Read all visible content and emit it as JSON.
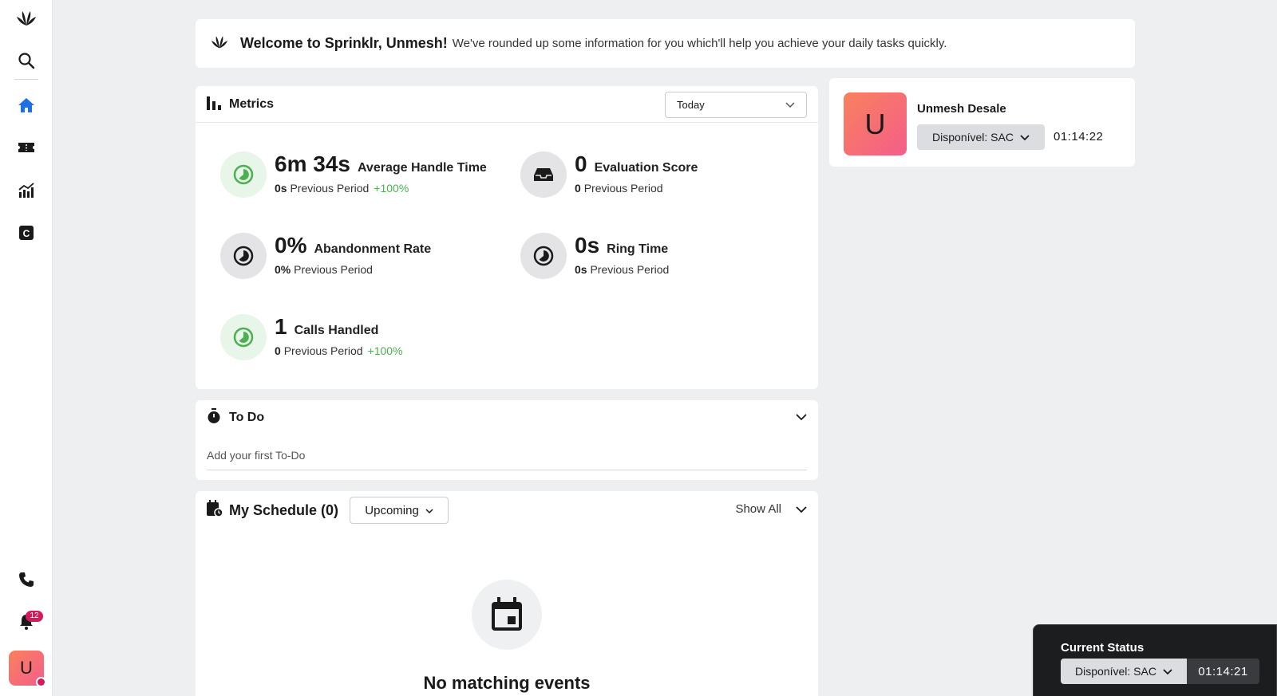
{
  "welcome": {
    "title": "Welcome to Sprinklr, Unmesh!",
    "subtitle": "We've rounded up some information for you which'll help you achieve your daily tasks quickly."
  },
  "sidebar": {
    "items": [
      {
        "name": "search",
        "icon": "search-icon"
      },
      {
        "name": "home",
        "icon": "home-icon"
      },
      {
        "name": "tickets",
        "icon": "ticket-icon"
      },
      {
        "name": "analytics",
        "icon": "chart-icon"
      },
      {
        "name": "c-app",
        "icon": "c-icon"
      }
    ],
    "notification_count": "12",
    "avatar_initial": "U"
  },
  "metrics": {
    "title": "Metrics",
    "period_selected": "Today",
    "items": [
      {
        "value": "6m 34s",
        "label": "Average Handle Time",
        "prev_value": "0s",
        "prev_label": "Previous Period",
        "delta": "+100%"
      },
      {
        "value": "0",
        "label": "Evaluation Score",
        "prev_value": "0",
        "prev_label": "Previous Period",
        "delta": ""
      },
      {
        "value": "0%",
        "label": "Abandonment Rate",
        "prev_value": "0%",
        "prev_label": "Previous Period",
        "delta": ""
      },
      {
        "value": "0s",
        "label": "Ring Time",
        "prev_value": "0s",
        "prev_label": "Previous Period",
        "delta": ""
      },
      {
        "value": "1",
        "label": "Calls Handled",
        "prev_value": "0",
        "prev_label": "Previous Period",
        "delta": "+100%"
      }
    ]
  },
  "todo": {
    "title": "To Do",
    "placeholder": "Add your first To-Do"
  },
  "schedule": {
    "title": "My Schedule (0)",
    "filter": "Upcoming",
    "show_all": "Show All",
    "empty_text": "No matching events"
  },
  "profile": {
    "initial": "U",
    "name": "Unmesh Desale",
    "status": "Disponível: SAC",
    "timer": "01:14:22"
  },
  "current_status": {
    "title": "Current Status",
    "status": "Disponível: SAC",
    "timer": "01:14:21"
  },
  "colors": {
    "accent_blue": "#1f6fe5",
    "positive_green": "#4caf50",
    "avatar_gradient_start": "#f9815d",
    "avatar_gradient_end": "#f45d8a",
    "badge_red": "#d6195a"
  }
}
